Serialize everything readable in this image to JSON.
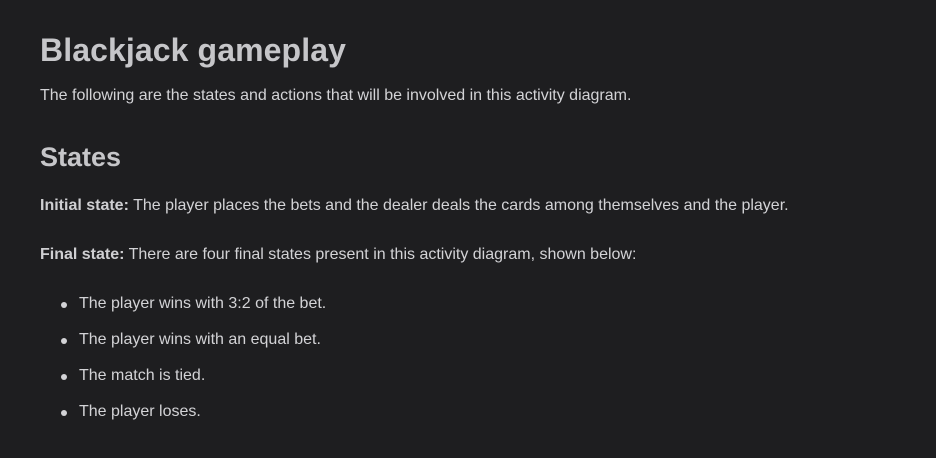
{
  "page": {
    "title": "Blackjack gameplay",
    "intro": "The following are the states and actions that will be involved in this activity diagram."
  },
  "states": {
    "heading": "States",
    "initial": {
      "label": "Initial state:",
      "text": " The player places the bets and the dealer deals the cards among themselves and the player."
    },
    "final": {
      "label": "Final state:",
      "text": " There are four final states present in this activity diagram, shown below:"
    },
    "outcomes": [
      "The player wins with 3:2 of the bet.",
      "The player wins with an equal bet.",
      "The match is tied.",
      "The player loses."
    ]
  }
}
